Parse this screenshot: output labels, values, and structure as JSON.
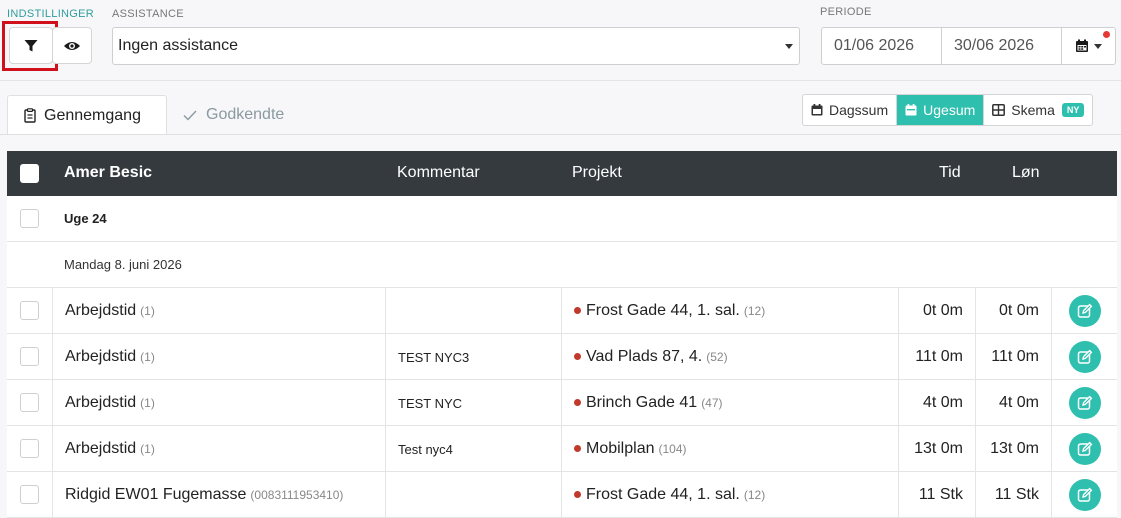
{
  "filters": {
    "settings_label": "INDSTILLINGER",
    "assistance_label": "ASSISTANCE",
    "assistance_value": "Ingen assistance",
    "period_label": "PERIODE",
    "date_from": "01/06 2026",
    "date_to": "30/06 2026"
  },
  "tabs": [
    {
      "label": "Gennemgang",
      "active": true
    },
    {
      "label": "Godkendte",
      "active": false
    }
  ],
  "views": [
    {
      "label": "Dagssum",
      "active": false
    },
    {
      "label": "Ugesum",
      "active": true
    },
    {
      "label": "Skema",
      "active": false,
      "badge": "NY"
    }
  ],
  "table": {
    "columns": {
      "name": "Amer Besic",
      "comment": "Kommentar",
      "project": "Projekt",
      "time": "Tid",
      "pay": "Løn"
    },
    "week_label": "Uge 24",
    "day_label": "Mandag 8. juni 2026",
    "rows": [
      {
        "name": "Arbejdstid",
        "count": "(1)",
        "comment": "",
        "project": "Frost Gade 44, 1. sal.",
        "project_count": "(12)",
        "time": "0t 0m",
        "pay": "0t 0m"
      },
      {
        "name": "Arbejdstid",
        "count": "(1)",
        "comment": "TEST NYC3",
        "project": "Vad Plads 87, 4.",
        "project_count": "(52)",
        "time": "11t 0m",
        "pay": "11t 0m"
      },
      {
        "name": "Arbejdstid",
        "count": "(1)",
        "comment": "TEST NYC",
        "project": "Brinch Gade 41",
        "project_count": "(47)",
        "time": "4t 0m",
        "pay": "4t 0m"
      },
      {
        "name": "Arbejdstid",
        "count": "(1)",
        "comment": "Test nyc4",
        "project": "Mobilplan",
        "project_count": "(104)",
        "time": "13t 0m",
        "pay": "13t 0m"
      },
      {
        "name": "Ridgid EW01 Fugemasse",
        "count": "(0083111953410)",
        "comment": "",
        "project": "Frost Gade 44, 1. sal.",
        "project_count": "(12)",
        "time": "11 Stk",
        "pay": "11 Stk"
      }
    ]
  },
  "colors": {
    "accent": "#2fbfaf",
    "header": "#353a3f",
    "highlight": "#d0111b",
    "project_dot": "#c0392b"
  }
}
